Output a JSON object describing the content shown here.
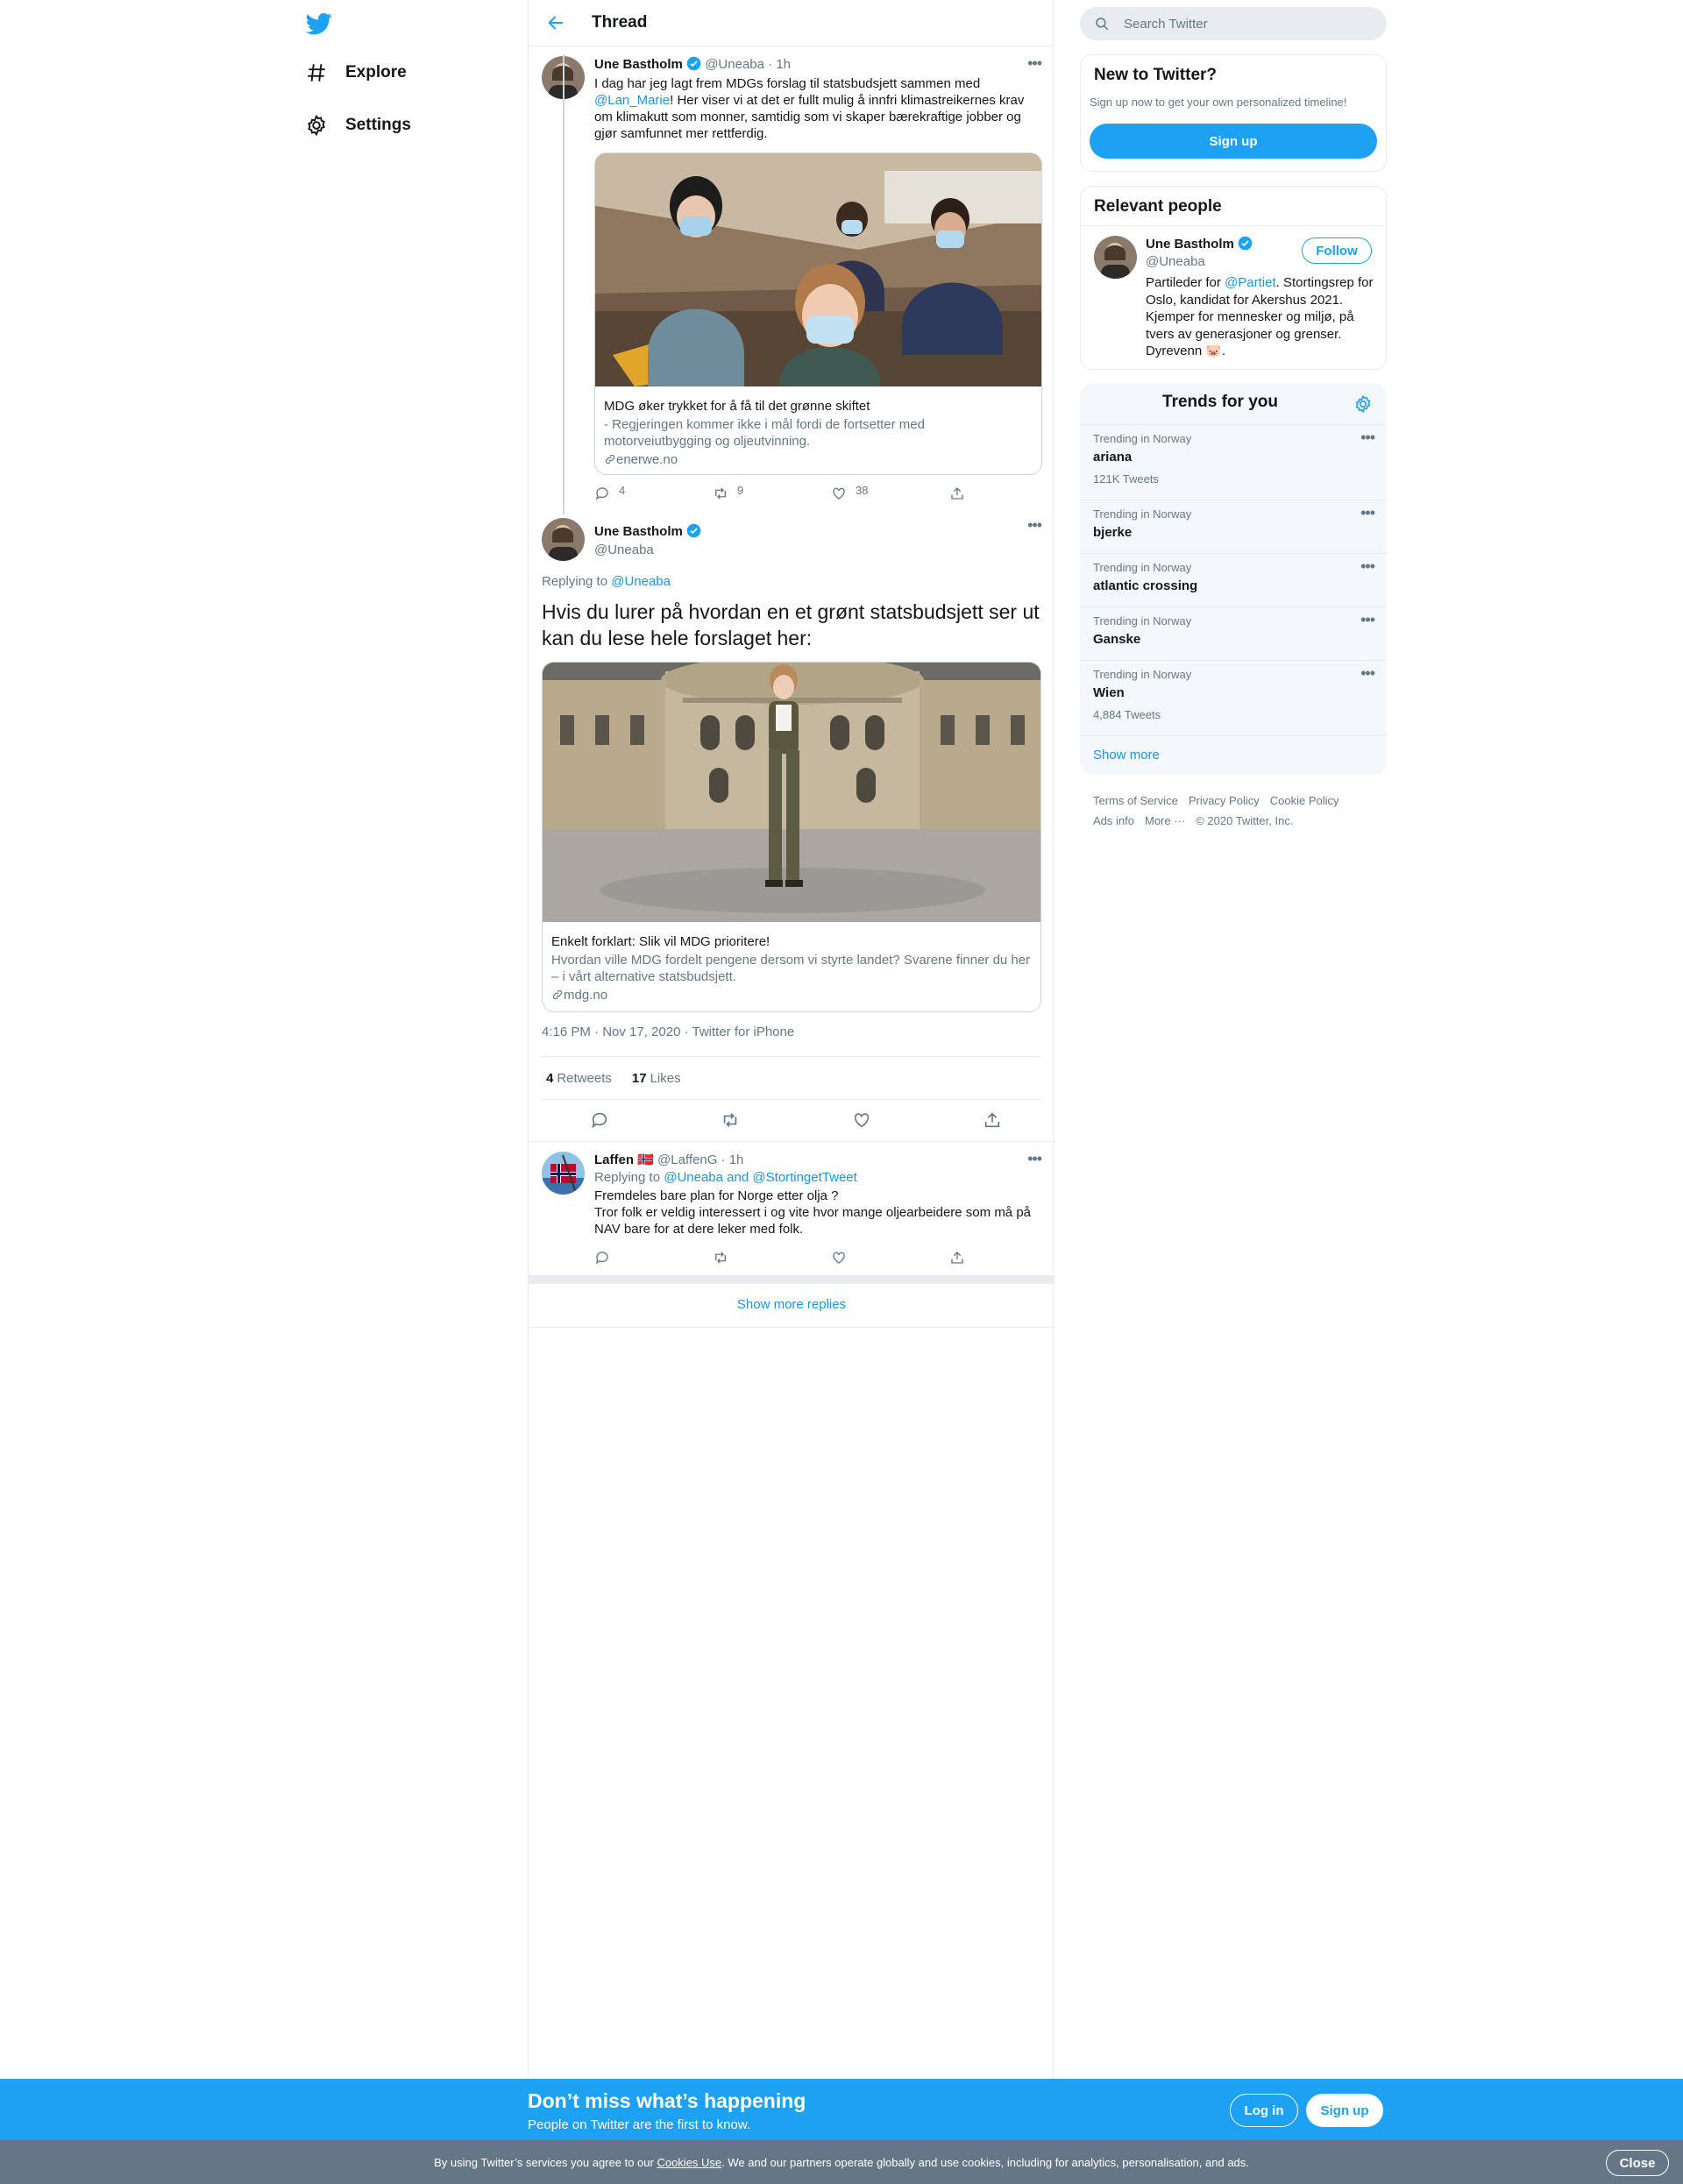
{
  "nav": {
    "items": [
      {
        "label": "Explore",
        "icon": "hashtag-icon"
      },
      {
        "label": "Settings",
        "icon": "gear-icon"
      }
    ]
  },
  "header": {
    "title": "Thread"
  },
  "tweet1": {
    "name": "Une Bastholm",
    "handle": "@Uneaba",
    "time": "· 1h",
    "text_parts": [
      "I dag har jeg lagt frem MDGs forslag til statsbudsjett sammen med ",
      "@Lan_Marie",
      "! Her viser vi at det er fullt mulig å innfri klimastreikernes krav om klimakutt som monner, samtidig som vi skaper bærekraftige jobber og gjør samfunnet mer rettferdig."
    ],
    "card": {
      "title": "MDG øker trykket for å få til det grønne skiftet",
      "description": "- Regjeringen kommer ikke i mål fordi de fortsetter med motorveiutbygging og oljeutvinning.",
      "domain": "enerwe.no"
    },
    "replies": "4",
    "retweets": "9",
    "likes": "38"
  },
  "tweet2": {
    "name": "Une Bastholm",
    "handle": "@Uneaba",
    "replying_prefix": "Replying to ",
    "replying_to": "@Uneaba",
    "text": "Hvis du lurer på hvordan en et grønt statsbudsjett ser ut kan du lese hele forslaget her:",
    "card": {
      "title": "Enkelt forklart: Slik vil MDG prioritere!",
      "description": "Hvordan ville MDG fordelt pengene dersom vi styrte landet? Svarene finner du her – i vårt alternative statsbudsjett.",
      "domain": "mdg.no"
    },
    "timestamp": "4:16 PM · Nov 17, 2020 · Twitter for iPhone",
    "retweets_count": "4",
    "retweets_label": "Retweets",
    "likes_count": "17",
    "likes_label": "Likes"
  },
  "reply": {
    "name": "Laffen",
    "flag": "🇳🇴",
    "handle": "@LaffenG",
    "time": "· 1h",
    "replying_prefix": "Replying to ",
    "replying_to": "@Uneaba and @StortingetTweet",
    "line1": "Fremdeles bare plan for Norge etter olja ?",
    "line2": "Tror folk er veldig interessert i og vite hvor mange oljearbeidere som må på NAV bare for at dere leker med folk."
  },
  "show_more_replies": "Show more replies",
  "search": {
    "placeholder": "Search Twitter"
  },
  "new_to_twitter": {
    "title": "New to Twitter?",
    "subtitle": "Sign up now to get your own personalized timeline!",
    "button": "Sign up"
  },
  "relevant_people": {
    "title": "Relevant people",
    "name": "Une Bastholm",
    "handle": "@Uneaba",
    "follow": "Follow",
    "bio_prefix": "Partileder for ",
    "bio_link": "@Partiet",
    "bio_rest": ". Stortingsrep for Oslo, kandidat for Akershus 2021. Kjemper for mennesker og miljø, på tvers av generasjoner og grenser. Dyrevenn 🐷."
  },
  "trends": {
    "title": "Trends for you",
    "items": [
      {
        "context": "Trending in Norway",
        "name": "ariana",
        "count": "121K Tweets"
      },
      {
        "context": "Trending in Norway",
        "name": "bjerke",
        "count": ""
      },
      {
        "context": "Trending in Norway",
        "name": "atlantic crossing",
        "count": ""
      },
      {
        "context": "Trending in Norway",
        "name": "Ganske",
        "count": ""
      },
      {
        "context": "Trending in Norway",
        "name": "Wien",
        "count": "4,884 Tweets"
      }
    ],
    "show_more": "Show more"
  },
  "footer": {
    "links": [
      "Terms of Service",
      "Privacy Policy",
      "Cookie Policy",
      "Ads info",
      "More ···"
    ],
    "copyright": "© 2020 Twitter, Inc."
  },
  "bottom_banner": {
    "headline": "Don’t miss what’s happening",
    "sub": "People on Twitter are the first to know.",
    "login": "Log in",
    "signup": "Sign up"
  },
  "cookie": {
    "prefix": "By using Twitter’s services you agree to our ",
    "link": "Cookies Use",
    "suffix": ". We and our partners operate globally and use cookies, including for analytics, personalisation, and ads.",
    "close": "Close"
  },
  "colors": {
    "accent": "#1da1f2",
    "link": "#1b95e0",
    "secondary_text": "#657786",
    "border": "#e6ecf0",
    "cookie_bar": "#657786"
  }
}
